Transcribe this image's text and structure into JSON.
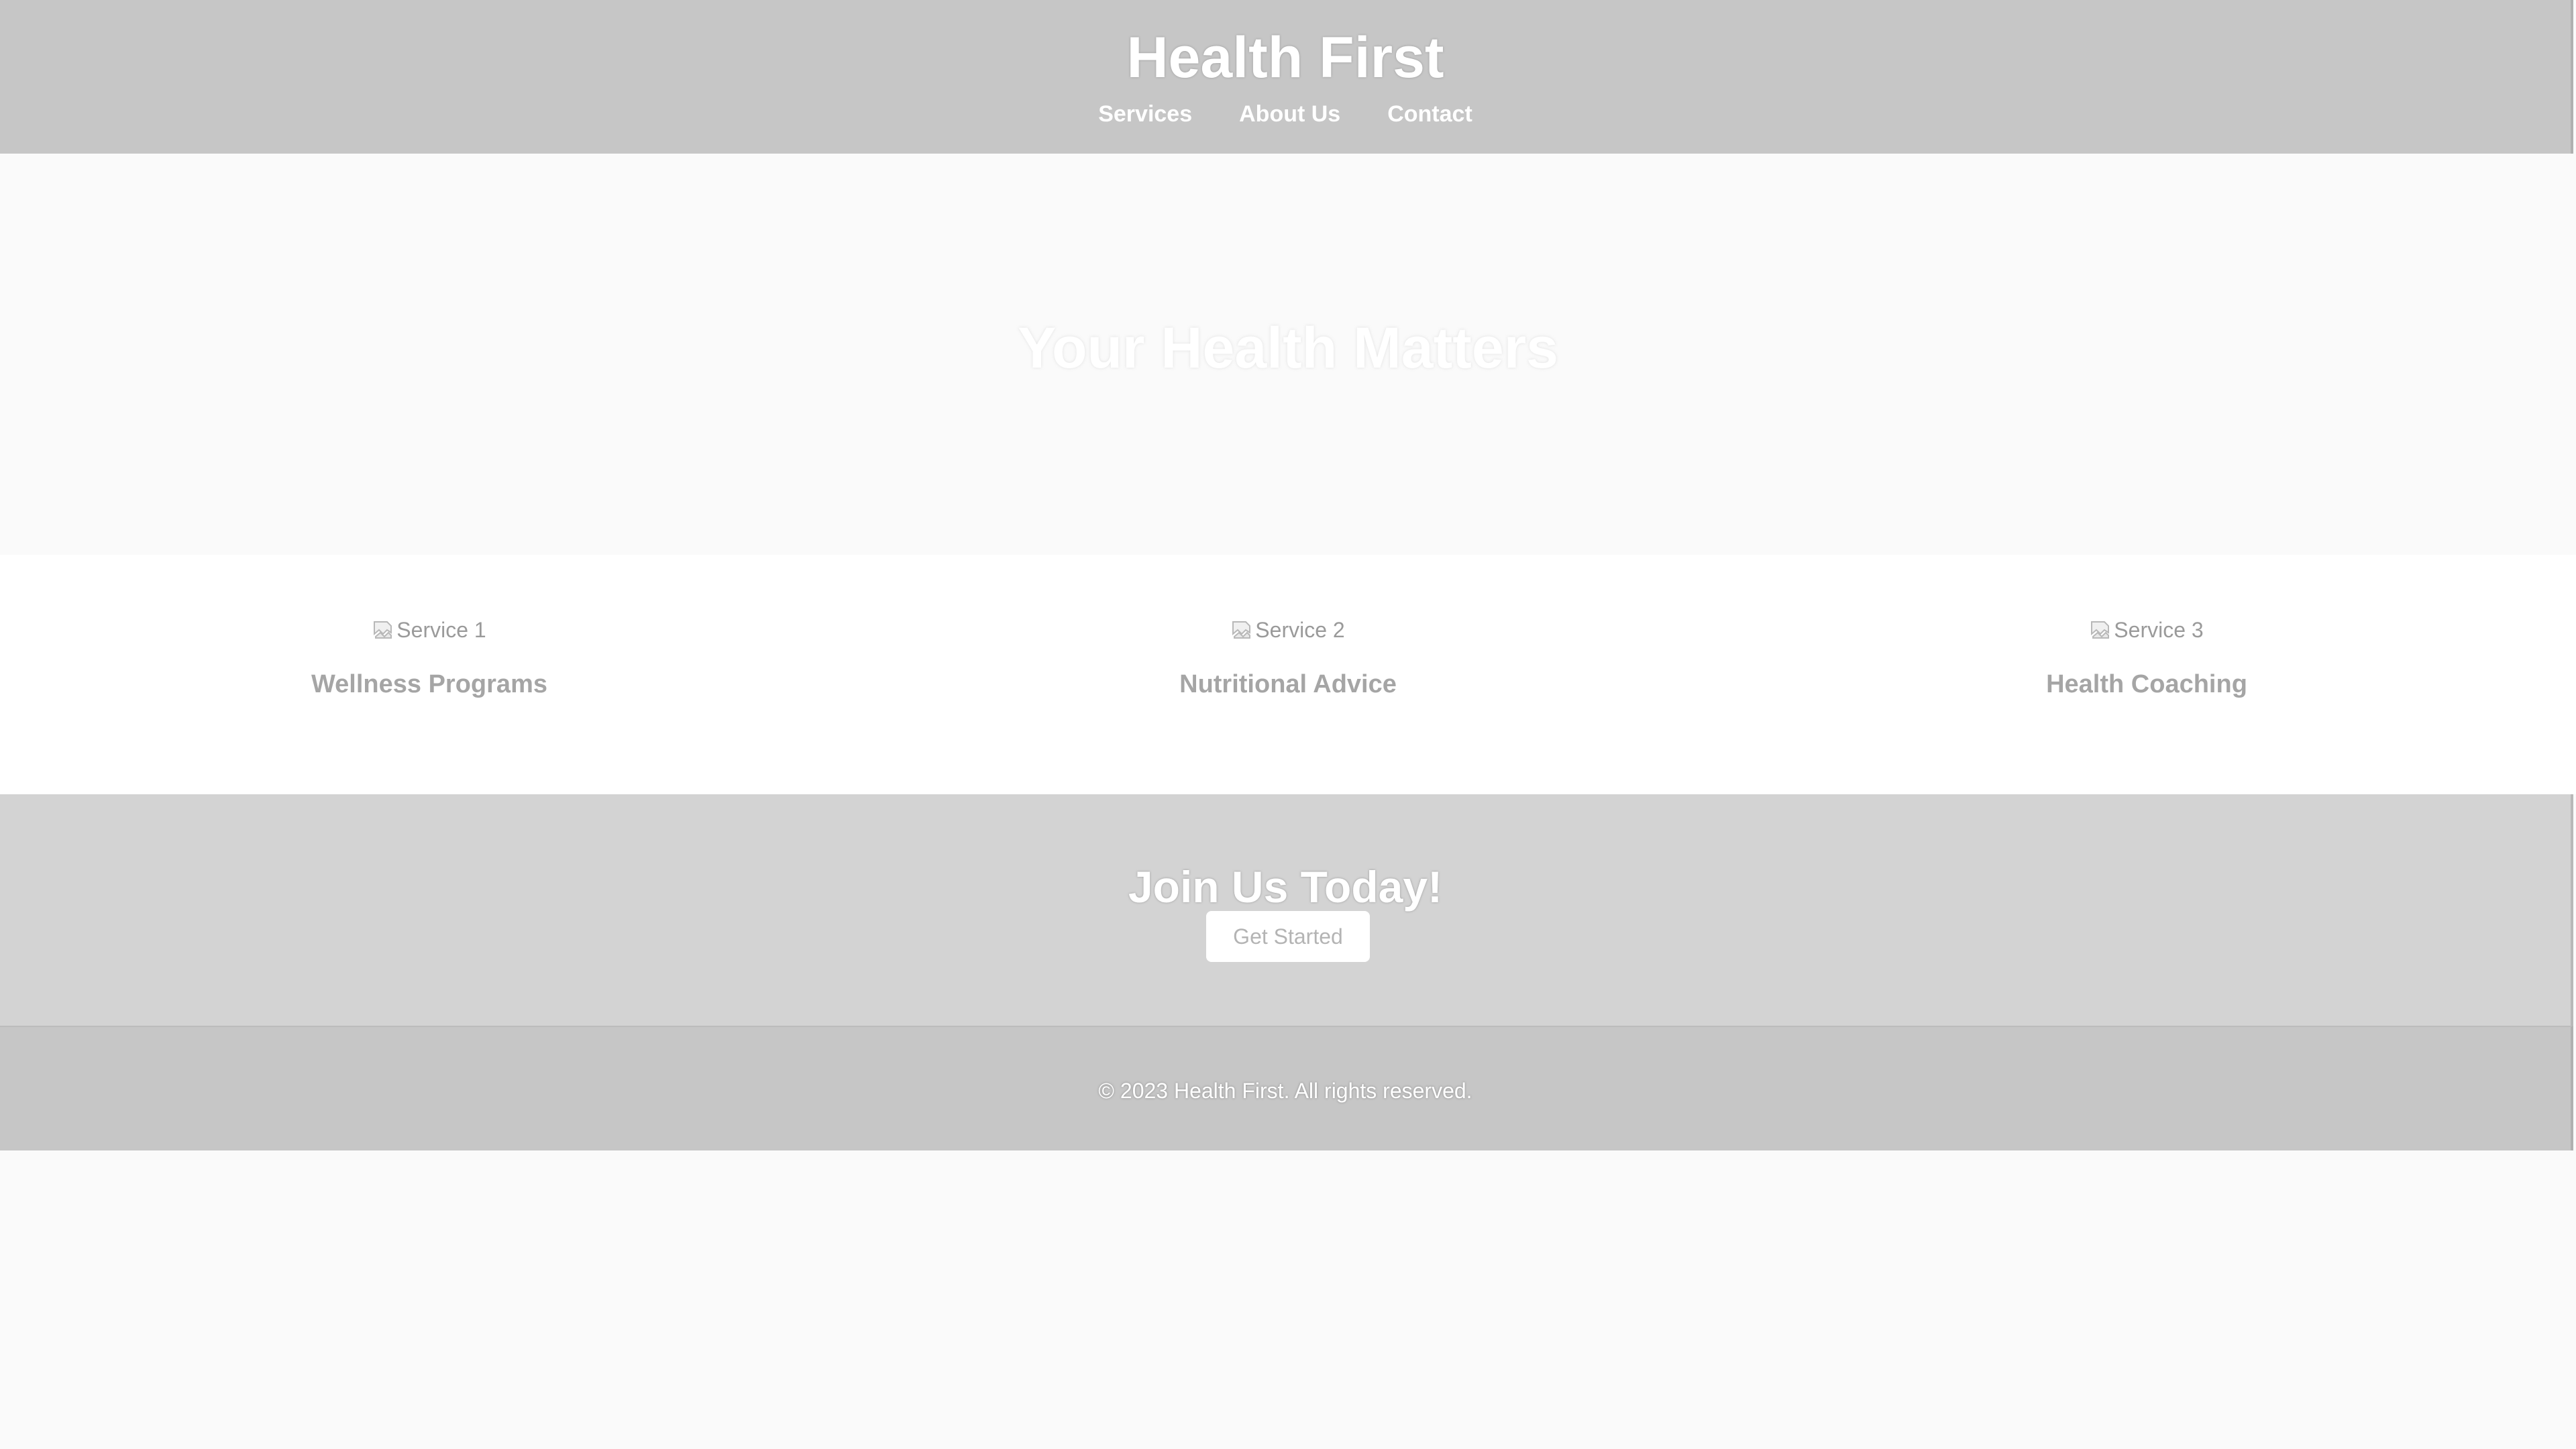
{
  "header": {
    "title": "Health First",
    "nav": [
      {
        "label": "Services"
      },
      {
        "label": "About Us"
      },
      {
        "label": "Contact"
      }
    ]
  },
  "hero": {
    "title": "Your Health Matters"
  },
  "services": [
    {
      "image_alt": "Service 1",
      "title": "Wellness Programs"
    },
    {
      "image_alt": "Service 2",
      "title": "Nutritional Advice"
    },
    {
      "image_alt": "Service 3",
      "title": "Health Coaching"
    }
  ],
  "cta": {
    "title": "Join Us Today!",
    "button_label": "Get Started"
  },
  "footer": {
    "text": "© 2023 Health First. All rights reserved."
  },
  "colors": {
    "header_bg": "#c6c6c6",
    "hero_bg": "#fafafa",
    "services_bg": "#ffffff",
    "cta_bg": "#d3d3d3",
    "footer_bg": "#c6c6c6"
  }
}
